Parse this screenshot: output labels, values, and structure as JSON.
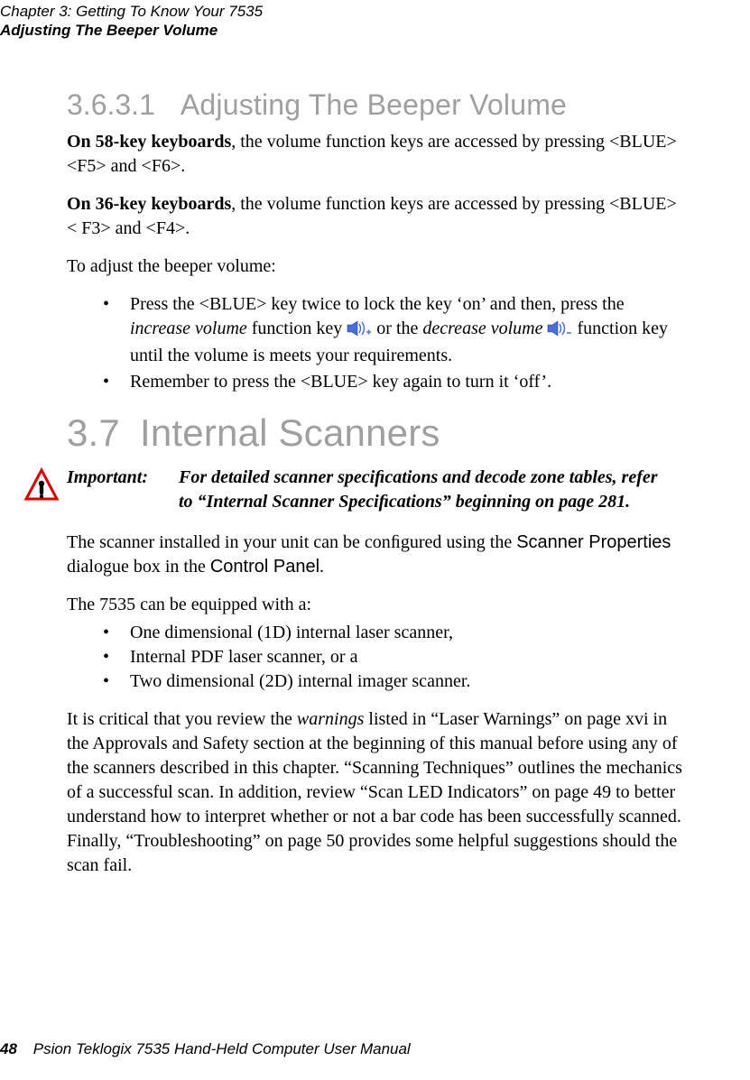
{
  "header": {
    "chapter": "Chapter  3:  Getting To Know Your 7535",
    "section": "Adjusting The Beeper Volume"
  },
  "h1": {
    "num": "3.6.3.1",
    "title": "Adjusting The Beeper Volume"
  },
  "p1": {
    "lead": "On 58-key keyboards",
    "rest": ", the volume function keys are accessed by pressing <BLUE> <F5> and <F6>."
  },
  "p2": {
    "lead": "On 36-key keyboards",
    "rest": ", the volume function keys are accessed by pressing <BLUE> < F3> and <F4>."
  },
  "p3": "To adjust the beeper volume:",
  "b1": {
    "a": "Press the <BLUE> key twice to lock the key ‘on’ and then, press the ",
    "inc": "increase volume",
    "b": " function key ",
    "c": " or the ",
    "dec": "decrease volume",
    "d": " ",
    "e": " function key until the volume is meets your requirements."
  },
  "b2": "Remember to press the <BLUE> key again to turn it ‘off’.",
  "h2": {
    "num": "3.7",
    "title": "Internal Scanners"
  },
  "important": {
    "label": "Important:",
    "text": "For detailed scanner speciﬁcations and decode zone tables, refer to “Internal Scanner Speciﬁcations” beginning on page 281."
  },
  "p4": {
    "a": "The scanner installed in your unit can be conﬁgured using the ",
    "ui1": "Scanner Properties",
    "b": " dialogue box in the ",
    "ui2": "Control Panel",
    "c": "."
  },
  "p5": "The 7535 can be equipped with a:",
  "list": {
    "i1": "One dimensional (1D) internal laser scanner,",
    "i2": "Internal PDF laser scanner, or a",
    "i3": "Two dimensional (2D) internal imager scanner."
  },
  "p6": {
    "a": "It is critical that you review the ",
    "w": "warnings",
    "b": " listed in “Laser Warnings” on page xvi in the Approvals and Safety section at the beginning of this manual before using any of the scanners described in this chapter. “Scanning Techniques” outlines the mechanics of a successful scan. In addition, review “Scan LED Indicators” on page 49 to better understand how to interpret whether or not a bar code has been successfully scanned. Finally, “Troubleshooting” on page 50 provides some helpful suggestions should the scan fail."
  },
  "footer": {
    "page": "48",
    "book": "Psion Teklogix 7535 Hand-Held Computer User Manual"
  }
}
